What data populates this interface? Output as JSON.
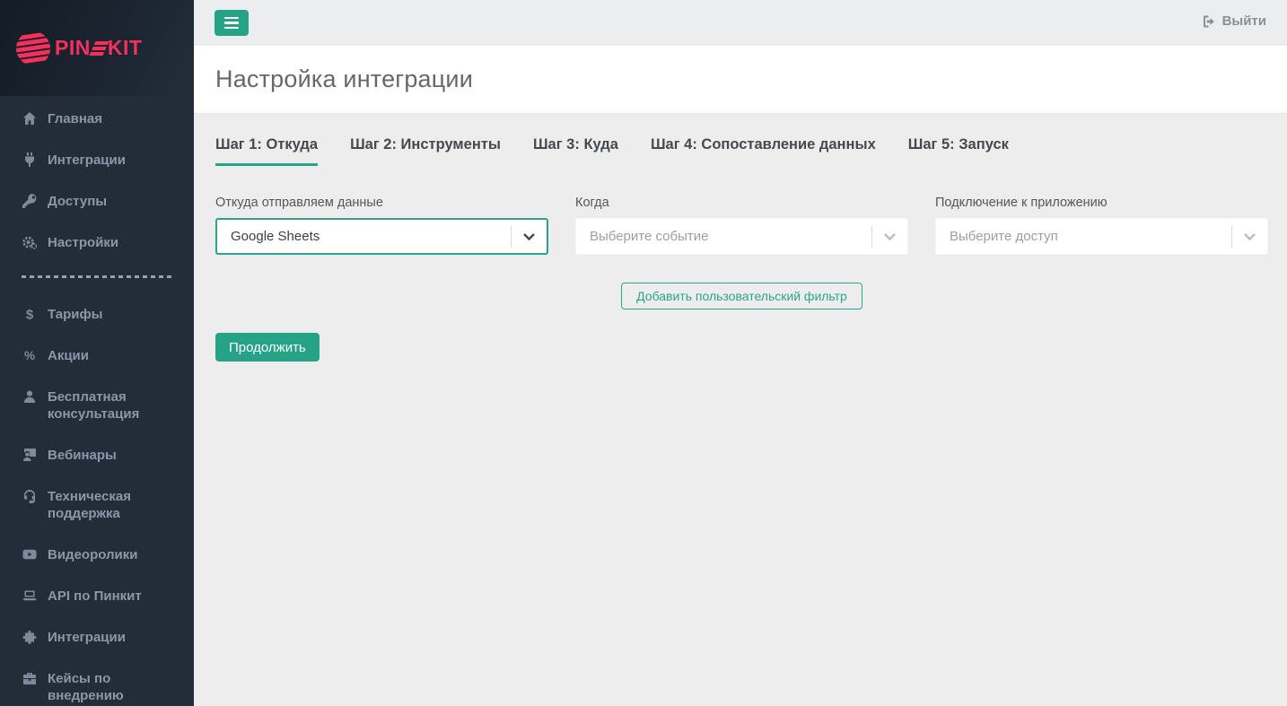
{
  "brand": {
    "name": "PINKIT",
    "wordmark_left": "PIN",
    "wordmark_right": "KIT",
    "logo_icon": "striped-circle-icon",
    "color": "#f4305b"
  },
  "topbar": {
    "menu_button_icon": "hamburger-icon",
    "logout_label": "Выйти",
    "logout_icon": "sign-out-icon"
  },
  "page": {
    "title": "Настройка интеграции"
  },
  "sidebar": {
    "items": [
      {
        "icon": "home-icon",
        "label": "Главная"
      },
      {
        "icon": "plug-icon",
        "label": "Интеграции"
      },
      {
        "icon": "key-icon",
        "label": "Доступы"
      },
      {
        "icon": "gears-icon",
        "label": "Настройки"
      },
      {
        "icon": "dollar-icon",
        "label": "Тарифы"
      },
      {
        "icon": "percent-icon",
        "label": "Акции"
      },
      {
        "icon": "user-icon",
        "label": "Бесплатная консультация"
      },
      {
        "icon": "webinar-icon",
        "label": "Вебинары"
      },
      {
        "icon": "headset-icon",
        "label": "Техническая поддержка"
      },
      {
        "icon": "youtube-icon",
        "label": "Видеоролики"
      },
      {
        "icon": "laptop-icon",
        "label": "API по Пинкит"
      },
      {
        "icon": "puzzle-icon",
        "label": "Интеграции"
      },
      {
        "icon": "briefcase-icon",
        "label": "Кейсы по внедрению"
      }
    ]
  },
  "tabs": [
    {
      "label": "Шаг 1: Откуда",
      "active": true
    },
    {
      "label": "Шаг 2: Инструменты",
      "active": false
    },
    {
      "label": "Шаг 3: Куда",
      "active": false
    },
    {
      "label": "Шаг 4: Сопоставление данных",
      "active": false
    },
    {
      "label": "Шаг 5: Запуск",
      "active": false
    }
  ],
  "form": {
    "fields": [
      {
        "label": "Откуда отправляем данные",
        "value": "Google Sheets",
        "state": "selected"
      },
      {
        "label": "Когда",
        "placeholder": "Выберите событие",
        "state": "empty"
      },
      {
        "label": "Подключение к приложению",
        "placeholder": "Выберите доступ",
        "state": "empty"
      }
    ],
    "filter_button_label": "Добавить пользовательский фильтр",
    "continue_button_label": "Продолжить"
  },
  "colors": {
    "accent_green": "#26a387",
    "select_border_green": "#2aa58b",
    "brand_pink": "#f4305b",
    "sidebar_bg": "#232d3a",
    "topbar_bg": "#ebedee",
    "content_bg": "#ededee"
  }
}
